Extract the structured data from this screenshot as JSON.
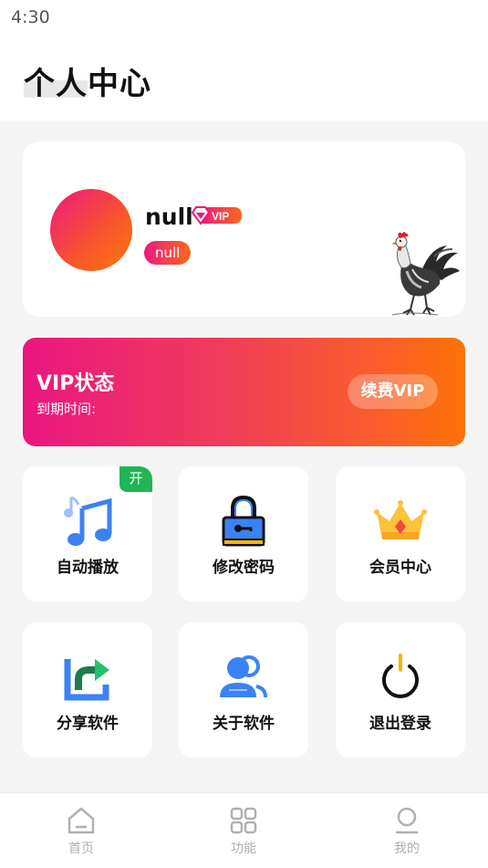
{
  "status_bar": {
    "time": "4:30"
  },
  "header": {
    "title": "个人中心"
  },
  "profile": {
    "username": "null",
    "vip_badge_text": "VIP",
    "tag": "null"
  },
  "vip": {
    "title": "VIP状态",
    "expire_label": "到期时间:",
    "renew_label": "续费VIP"
  },
  "tiles": [
    {
      "label": "自动播放",
      "icon": "music-notes-icon",
      "badge": "开"
    },
    {
      "label": "修改密码",
      "icon": "lock-icon"
    },
    {
      "label": "会员中心",
      "icon": "crown-icon"
    },
    {
      "label": "分享软件",
      "icon": "share-icon"
    },
    {
      "label": "关于软件",
      "icon": "users-icon"
    },
    {
      "label": "退出登录",
      "icon": "power-icon"
    }
  ],
  "bottom_nav": [
    {
      "label": "首页",
      "icon": "home-icon"
    },
    {
      "label": "功能",
      "icon": "grid-icon"
    },
    {
      "label": "我的",
      "icon": "person-icon"
    }
  ],
  "colors": {
    "accent_start": "#ea1680",
    "accent_end": "#fd7307",
    "toggle_green": "#1fb653",
    "icon_blue": "#3b82f6"
  }
}
